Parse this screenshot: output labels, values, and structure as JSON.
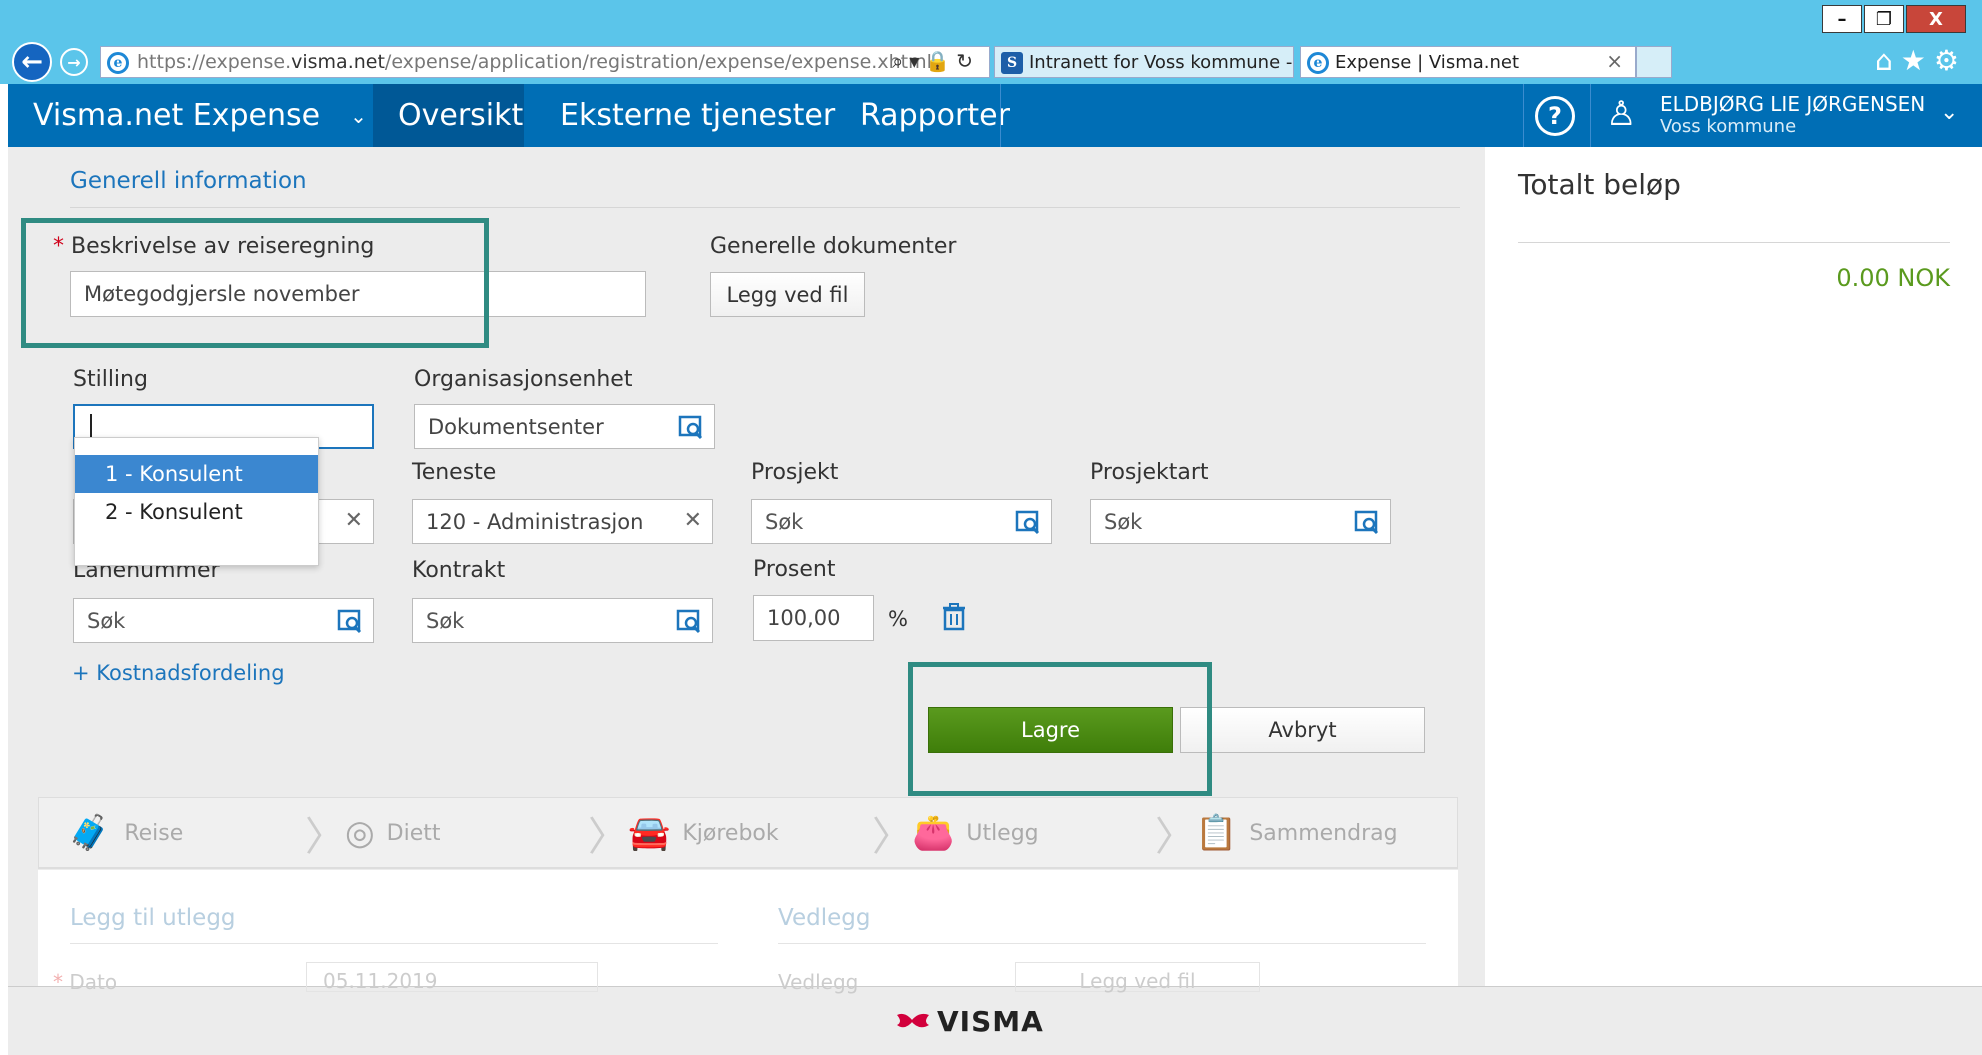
{
  "browser": {
    "url_prefix": "https://expense.",
    "url_domain": "visma.net",
    "url_path": "/expense/application/registration/expense/expense.xhtml",
    "tabs": [
      {
        "label": "Intranett for Voss kommune - ..."
      },
      {
        "label": "Expense | Visma.net"
      }
    ],
    "window_buttons": {
      "minimize": "–",
      "restore": "❐",
      "close": "X"
    }
  },
  "header": {
    "app_title": "Visma.net Expense",
    "menu": [
      "Oversikt",
      "Eksterne tjenester",
      "Rapporter"
    ],
    "user_name": "ELDBJØRG LIE JØRGENSEN",
    "user_org": "Voss kommune",
    "help_icon": "?"
  },
  "form": {
    "section_title": "Generell information",
    "description_label": "Beskrivelse av reiseregning",
    "required_mark": "*",
    "description_value": "Møtegodgjersle november",
    "documents_label": "Generelle dokumenter",
    "attach_button": "Legg ved fil",
    "stilling_label": "Stilling",
    "stilling_options": [
      "1 - Konsulent",
      "2 - Konsulent"
    ],
    "org_label": "Organisasjonsenhet",
    "org_value": "Dokumentsenter",
    "teneste_label": "Teneste",
    "teneste_value": "120 - Administrasjon",
    "prosjekt_label": "Prosjekt",
    "prosjekt_placeholder": "Søk",
    "prosjektart_label": "Prosjektart",
    "prosjektart_placeholder": "Søk",
    "lanenummer_label": "Lanenummer",
    "lanenummer_placeholder": "Søk",
    "kontrakt_label": "Kontrakt",
    "kontrakt_placeholder": "Søk",
    "prosent_label": "Prosent",
    "prosent_value": "100,00",
    "prosent_unit": "%",
    "cost_distribution_link": "+ Kostnadsfordeling",
    "save_button": "Lagre",
    "cancel_button": "Avbryt"
  },
  "steps": [
    "Reise",
    "Diett",
    "Kjørebok",
    "Utlegg",
    "Sammendrag"
  ],
  "lower": {
    "add_expense_title": "Legg til utlegg",
    "attachments_title": "Vedlegg",
    "date_label": "Dato",
    "date_value": "05.11.2019",
    "attachment_label": "Vedlegg",
    "attach_button": "Legg ved fil"
  },
  "summary": {
    "title": "Totalt beløp",
    "amount": "0.00 NOK"
  },
  "footer": {
    "logo": "VISMA"
  },
  "colors": {
    "brand": "#006eb5",
    "save": "#4a8a0e",
    "amount": "#5a9a1e",
    "highlight": "#2f8b82"
  }
}
